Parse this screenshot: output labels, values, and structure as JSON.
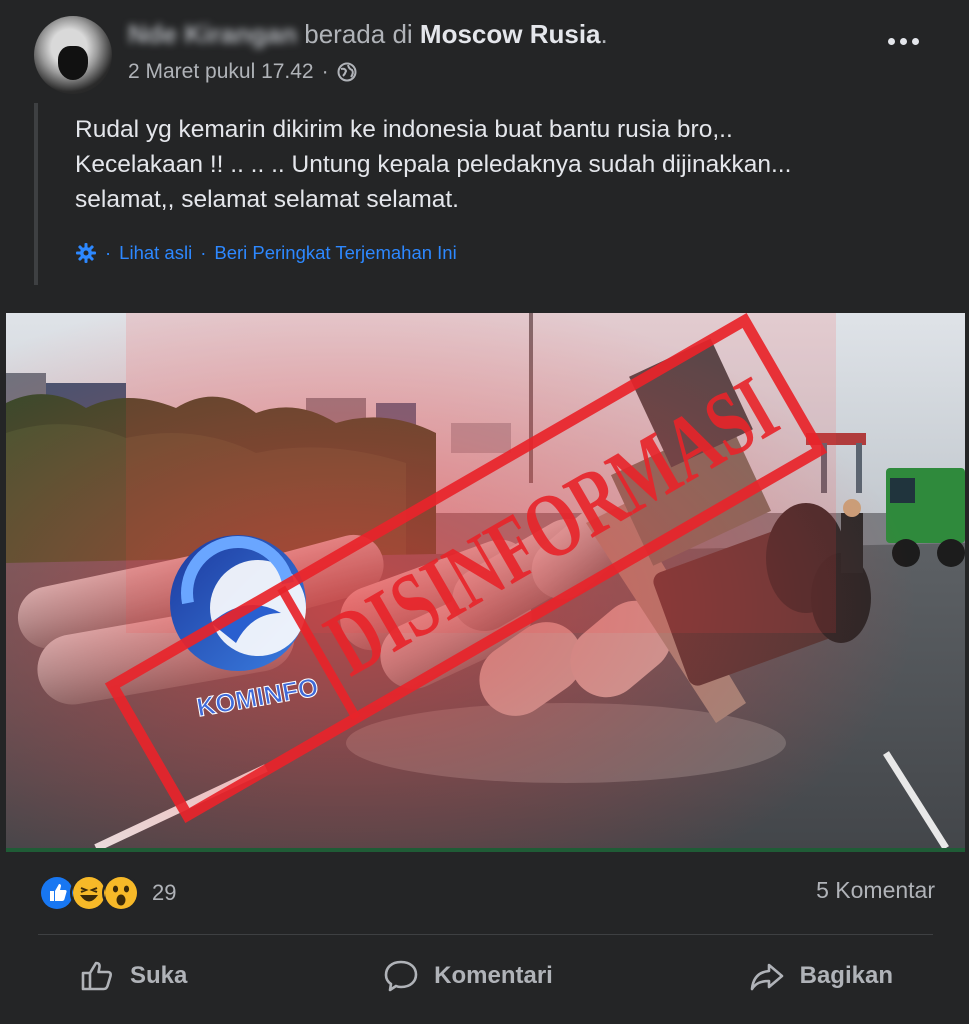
{
  "header": {
    "author_name": "Nde Kirangan",
    "location_prefix": "berada di",
    "location": "Moscow Rusia",
    "location_suffix": ".",
    "timestamp": "2 Maret pukul 17.42",
    "separator": "·",
    "privacy_icon": "globe-icon",
    "menu_icon": "more-options-icon"
  },
  "post": {
    "lines": [
      "Rudal yg kemarin dikirim ke indonesia buat bantu rusia bro,..",
      "Kecelakaan !! .. .. .. Untung kepala peledaknya sudah dijinakkan...",
      "selamat,, selamat selamat selamat."
    ],
    "translate_links": {
      "separator": "·",
      "see_original": "Lihat asli",
      "rate_translation": "Beri Peringkat Terjemahan Ini"
    }
  },
  "image": {
    "stamp_text": "DISINFORMASI",
    "logo_text": "KOMINFO",
    "stamp_color": "#e8242a"
  },
  "footer": {
    "reaction_count": "29",
    "reactions": [
      "like-icon",
      "haha-icon",
      "wow-icon"
    ],
    "comment_count": "5 Komentar",
    "actions": {
      "like": "Suka",
      "comment": "Komentari",
      "share": "Bagikan"
    }
  },
  "colors": {
    "background": "#242526",
    "text": "#e4e6eb",
    "muted": "#b0b3b8",
    "link": "#2d88ff"
  }
}
